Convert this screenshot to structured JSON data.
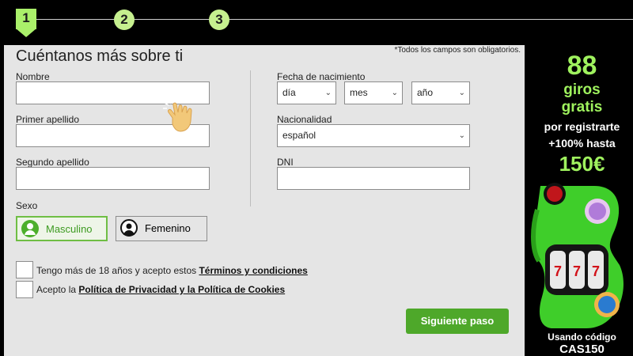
{
  "stepper": {
    "steps": [
      "1",
      "2",
      "3"
    ],
    "active": "1"
  },
  "form": {
    "title": "Cuéntanos más sobre ti",
    "required_note": "*Todos los campos son obligatorios.",
    "nombre_label": "Nombre",
    "nombre_value": "",
    "primer_apellido_label": "Primer apellido",
    "primer_apellido_value": "",
    "segundo_apellido_label": "Segundo apellido",
    "segundo_apellido_value": "",
    "sexo_label": "Sexo",
    "gender_options": [
      "Masculino",
      "Femenino"
    ],
    "gender_selected": "Masculino",
    "fecha_label": "Fecha de nacimiento",
    "dia": "día",
    "mes": "mes",
    "anio": "año",
    "nacionalidad_label": "Nacionalidad",
    "nacionalidad_value": "español",
    "dni_label": "DNI",
    "dni_value": "",
    "terms_prefix": "Tengo más de 18 años y acepto estos ",
    "terms_link": "Términos y condiciones",
    "privacy_prefix": "Acepto la ",
    "privacy_link": "Política de Privacidad y la Política de Cookies",
    "next_button": "Siguiente paso"
  },
  "promo": {
    "line1": "88",
    "line2": "giros",
    "line3": "gratis",
    "line4": "por registrarte",
    "line5": "+100% hasta",
    "line6": "150€",
    "bottom1": "Usando código",
    "bottom2": "CAS150",
    "colors": {
      "accent": "#9ff25e",
      "green": "#3fce2a"
    }
  },
  "colors": {
    "button": "#4ea82a",
    "selected": "#6fbe44",
    "panel": "#e5e5e5"
  }
}
